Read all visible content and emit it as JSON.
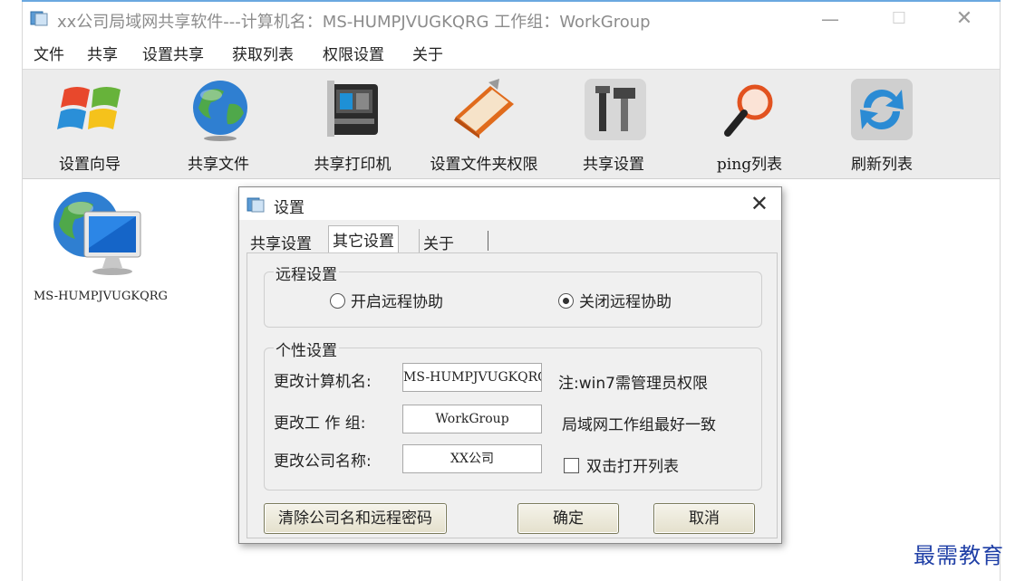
{
  "app": {
    "title": "xx公司局域网共享软件---计算机名：MS-HUMPJVUGKQRG   工作组：WorkGroup",
    "controls": {
      "minimize": "—",
      "maximize": "☐",
      "close": "✕"
    }
  },
  "menu": [
    "文件",
    "共享",
    "设置共享",
    "获取列表",
    "权限设置",
    "关于"
  ],
  "toolbar": [
    {
      "label": "设置向导",
      "icon": "windows-logo-icon"
    },
    {
      "label": "共享文件",
      "icon": "globe-icon"
    },
    {
      "label": "共享打印机",
      "icon": "printer-icon"
    },
    {
      "label": "设置文件夹权限",
      "icon": "folder-book-icon"
    },
    {
      "label": "共享设置",
      "icon": "tools-icon"
    },
    {
      "label": "ping列表",
      "icon": "magnifier-icon"
    },
    {
      "label": "刷新列表",
      "icon": "refresh-icon"
    }
  ],
  "computer": {
    "name": "MS-HUMPJVUGKQRG"
  },
  "dialog": {
    "title": "设置",
    "close": "✕",
    "tabs": [
      "共享设置",
      "其它设置",
      "关于"
    ],
    "active_tab": "其它设置",
    "remote": {
      "group": "远程设置",
      "enable": "开启远程协助",
      "disable": "关闭远程协助",
      "selected": "关闭远程协助"
    },
    "personal": {
      "group": "个性设置",
      "computer_name_label": "更改计算机名:",
      "computer_name_value": "MS-HUMPJVUGKQRG",
      "computer_name_note": "注:win7需管理员权限",
      "workgroup_label": "更改工  作 组:",
      "workgroup_value": "WorkGroup",
      "workgroup_note": "局域网工作组最好一致",
      "company_label": "更改公司名称:",
      "company_value": "XX公司",
      "dblclick_label": "双击打开列表",
      "dblclick_checked": false
    },
    "buttons": {
      "clear": "清除公司名和远程密码",
      "ok": "确定",
      "cancel": "取消"
    }
  },
  "watermark": "最需教育",
  "colors": {
    "accent": "#6aa8e0",
    "toolbar_bg": "#ececec",
    "dialog_bg": "#f0f0f0",
    "watermark": "#1f3fa6"
  }
}
